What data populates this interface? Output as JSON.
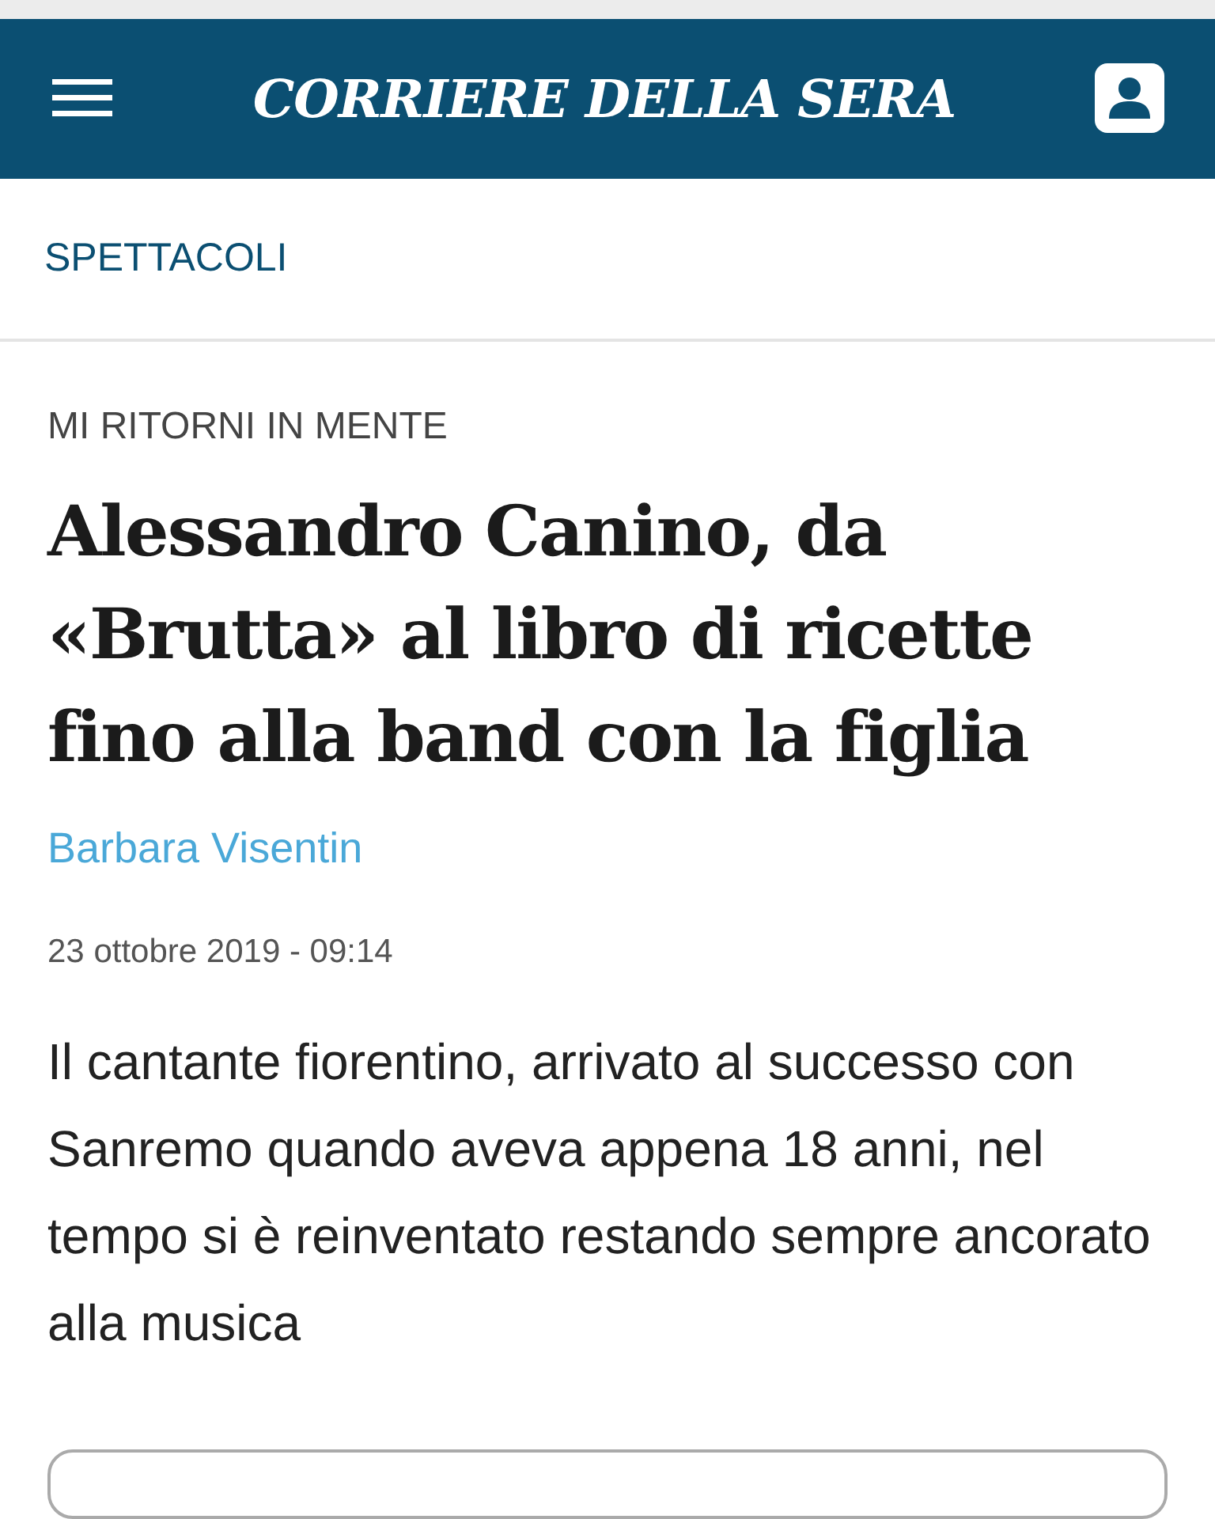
{
  "header": {
    "logo": "CORRIERE DELLA SERA"
  },
  "section": {
    "label": "SPETTACOLI"
  },
  "article": {
    "kicker": "MI RITORNI IN MENTE",
    "title": "Alessandro Canino, da «Brutta» al libro di ricette fino alla band con la figlia",
    "author": "Barbara Visentin",
    "date": "23 ottobre 2019 - 09:14",
    "summary": "Il cantante fiorentino, arrivato al successo con Sanremo quando aveva appena 18 anni, nel tempo si è reinventato restando sempre ancorato alla musica"
  }
}
